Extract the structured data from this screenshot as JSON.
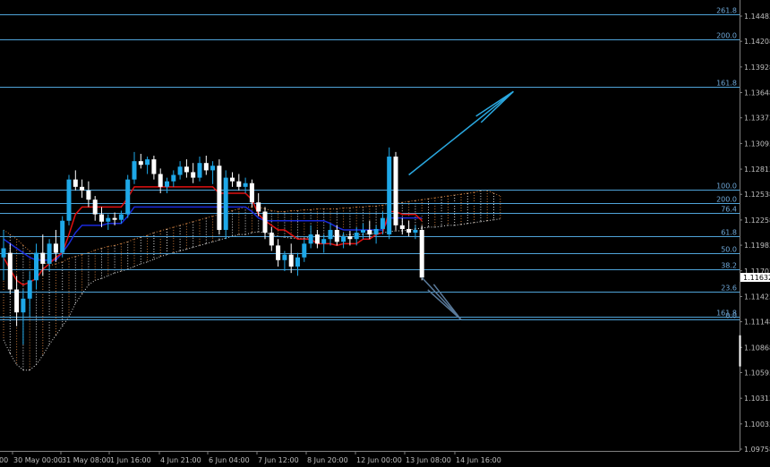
{
  "chart_data": {
    "type": "candlestick",
    "instrument": "",
    "y_axis": {
      "ticks": [
        "1.14483",
        "1.14208",
        "1.13928",
        "1.13648",
        "1.13373",
        "1.13093",
        "1.12813",
        "1.12538",
        "1.12258",
        "1.11983",
        "1.11703",
        "1.11423",
        "1.11148",
        "1.10868",
        "1.10593",
        "1.10313",
        "1.10033",
        "1.09758"
      ],
      "ylim": [
        1.09758,
        1.14483
      ],
      "current_price": "1.11632"
    },
    "x_axis": {
      "ticks": [
        "00",
        "30 May 00:00",
        "31 May 08:00",
        "1 Jun 16:00",
        "4 Jun 21:00",
        "6 Jun 04:00",
        "7 Jun 12:00",
        "8 Jun 20:00",
        "12 Jun 00:00",
        "13 Jun 08:00",
        "14 Jun 16:00"
      ]
    },
    "fibonacci_levels": [
      {
        "label": "261.8",
        "price": 1.145
      },
      {
        "label": "200.0",
        "price": 1.1423
      },
      {
        "label": "161.8",
        "price": 1.1371
      },
      {
        "label": "100.0",
        "price": 1.1259
      },
      {
        "label": "200.0",
        "price": 1.1244
      },
      {
        "label": "76.4",
        "price": 1.1234
      },
      {
        "label": "61.8",
        "price": 1.1208
      },
      {
        "label": "50.0",
        "price": 1.119
      },
      {
        "label": "38.2",
        "price": 1.1172
      },
      {
        "label": "23.6",
        "price": 1.1148
      },
      {
        "label": "161.8",
        "price": 1.112
      },
      {
        "label": "0.0",
        "price": 1.1117
      }
    ],
    "candles": [
      {
        "o": 1.1185,
        "h": 1.1215,
        "l": 1.116,
        "c": 1.1195
      },
      {
        "o": 1.119,
        "h": 1.12,
        "l": 1.1145,
        "c": 1.115
      },
      {
        "o": 1.115,
        "h": 1.1165,
        "l": 1.111,
        "c": 1.1125
      },
      {
        "o": 1.1125,
        "h": 1.115,
        "l": 1.109,
        "c": 1.114
      },
      {
        "o": 1.114,
        "h": 1.117,
        "l": 1.112,
        "c": 1.116
      },
      {
        "o": 1.116,
        "h": 1.12,
        "l": 1.115,
        "c": 1.119
      },
      {
        "o": 1.119,
        "h": 1.121,
        "l": 1.1165,
        "c": 1.1178
      },
      {
        "o": 1.1178,
        "h": 1.1205,
        "l": 1.117,
        "c": 1.12
      },
      {
        "o": 1.12,
        "h": 1.1215,
        "l": 1.118,
        "c": 1.119
      },
      {
        "o": 1.119,
        "h": 1.123,
        "l": 1.1185,
        "c": 1.1225
      },
      {
        "o": 1.1225,
        "h": 1.1275,
        "l": 1.122,
        "c": 1.127
      },
      {
        "o": 1.127,
        "h": 1.128,
        "l": 1.1258,
        "c": 1.1262
      },
      {
        "o": 1.1262,
        "h": 1.127,
        "l": 1.125,
        "c": 1.1258
      },
      {
        "o": 1.1258,
        "h": 1.1268,
        "l": 1.124,
        "c": 1.1248
      },
      {
        "o": 1.1248,
        "h": 1.1252,
        "l": 1.1225,
        "c": 1.1232
      },
      {
        "o": 1.1232,
        "h": 1.124,
        "l": 1.1218,
        "c": 1.1224
      },
      {
        "o": 1.1224,
        "h": 1.1232,
        "l": 1.1215,
        "c": 1.1228
      },
      {
        "o": 1.1228,
        "h": 1.1234,
        "l": 1.122,
        "c": 1.1226
      },
      {
        "o": 1.1226,
        "h": 1.1236,
        "l": 1.1222,
        "c": 1.1232
      },
      {
        "o": 1.1232,
        "h": 1.1275,
        "l": 1.1228,
        "c": 1.127
      },
      {
        "o": 1.127,
        "h": 1.13,
        "l": 1.1265,
        "c": 1.129
      },
      {
        "o": 1.129,
        "h": 1.1298,
        "l": 1.1282,
        "c": 1.1286
      },
      {
        "o": 1.1286,
        "h": 1.1295,
        "l": 1.1276,
        "c": 1.1292
      },
      {
        "o": 1.1292,
        "h": 1.1296,
        "l": 1.127,
        "c": 1.1276
      },
      {
        "o": 1.1276,
        "h": 1.1282,
        "l": 1.1255,
        "c": 1.1262
      },
      {
        "o": 1.1262,
        "h": 1.1272,
        "l": 1.1255,
        "c": 1.1268
      },
      {
        "o": 1.1268,
        "h": 1.128,
        "l": 1.1262,
        "c": 1.1275
      },
      {
        "o": 1.1275,
        "h": 1.129,
        "l": 1.127,
        "c": 1.1284
      },
      {
        "o": 1.1284,
        "h": 1.1292,
        "l": 1.1272,
        "c": 1.1278
      },
      {
        "o": 1.1278,
        "h": 1.1288,
        "l": 1.1266,
        "c": 1.1272
      },
      {
        "o": 1.1272,
        "h": 1.1295,
        "l": 1.1268,
        "c": 1.1288
      },
      {
        "o": 1.1288,
        "h": 1.1296,
        "l": 1.1275,
        "c": 1.128
      },
      {
        "o": 1.128,
        "h": 1.129,
        "l": 1.1265,
        "c": 1.1285
      },
      {
        "o": 1.1285,
        "h": 1.1292,
        "l": 1.121,
        "c": 1.1215
      },
      {
        "o": 1.1215,
        "h": 1.128,
        "l": 1.1205,
        "c": 1.1272
      },
      {
        "o": 1.1272,
        "h": 1.1278,
        "l": 1.1262,
        "c": 1.1268
      },
      {
        "o": 1.1268,
        "h": 1.1276,
        "l": 1.1258,
        "c": 1.1262
      },
      {
        "o": 1.1262,
        "h": 1.1272,
        "l": 1.1255,
        "c": 1.1266
      },
      {
        "o": 1.1266,
        "h": 1.127,
        "l": 1.124,
        "c": 1.1245
      },
      {
        "o": 1.1245,
        "h": 1.1255,
        "l": 1.123,
        "c": 1.1235
      },
      {
        "o": 1.1235,
        "h": 1.124,
        "l": 1.1205,
        "c": 1.1212
      },
      {
        "o": 1.1212,
        "h": 1.1218,
        "l": 1.1192,
        "c": 1.1198
      },
      {
        "o": 1.1198,
        "h": 1.1205,
        "l": 1.1175,
        "c": 1.1182
      },
      {
        "o": 1.1182,
        "h": 1.1192,
        "l": 1.117,
        "c": 1.1188
      },
      {
        "o": 1.1188,
        "h": 1.12,
        "l": 1.1168,
        "c": 1.1175
      },
      {
        "o": 1.1175,
        "h": 1.119,
        "l": 1.1165,
        "c": 1.1185
      },
      {
        "o": 1.1185,
        "h": 1.1205,
        "l": 1.118,
        "c": 1.12
      },
      {
        "o": 1.12,
        "h": 1.122,
        "l": 1.1195,
        "c": 1.121
      },
      {
        "o": 1.121,
        "h": 1.1215,
        "l": 1.1195,
        "c": 1.12
      },
      {
        "o": 1.12,
        "h": 1.121,
        "l": 1.119,
        "c": 1.1205
      },
      {
        "o": 1.1205,
        "h": 1.1222,
        "l": 1.1198,
        "c": 1.1215
      },
      {
        "o": 1.1215,
        "h": 1.122,
        "l": 1.1198,
        "c": 1.1202
      },
      {
        "o": 1.1202,
        "h": 1.1212,
        "l": 1.1195,
        "c": 1.1208
      },
      {
        "o": 1.1208,
        "h": 1.1214,
        "l": 1.1198,
        "c": 1.1205
      },
      {
        "o": 1.1205,
        "h": 1.1218,
        "l": 1.1198,
        "c": 1.1212
      },
      {
        "o": 1.1212,
        "h": 1.1222,
        "l": 1.1205,
        "c": 1.1215
      },
      {
        "o": 1.1215,
        "h": 1.1225,
        "l": 1.1205,
        "c": 1.121
      },
      {
        "o": 1.121,
        "h": 1.122,
        "l": 1.12,
        "c": 1.1216
      },
      {
        "o": 1.1216,
        "h": 1.1235,
        "l": 1.121,
        "c": 1.1228
      },
      {
        "o": 1.121,
        "h": 1.1305,
        "l": 1.1205,
        "c": 1.1295
      },
      {
        "o": 1.1295,
        "h": 1.13,
        "l": 1.1215,
        "c": 1.122
      },
      {
        "o": 1.122,
        "h": 1.1228,
        "l": 1.121,
        "c": 1.1216
      },
      {
        "o": 1.1216,
        "h": 1.1225,
        "l": 1.1208,
        "c": 1.1212
      },
      {
        "o": 1.1212,
        "h": 1.122,
        "l": 1.1205,
        "c": 1.1215
      },
      {
        "o": 1.1215,
        "h": 1.122,
        "l": 1.116,
        "c": 1.1163
      }
    ],
    "tenkan_red": [
      1.1185,
      1.1172,
      1.116,
      1.1155,
      1.1158,
      1.1162,
      1.1172,
      1.1178,
      1.1185,
      1.119,
      1.121,
      1.1232,
      1.124,
      1.124,
      1.124,
      1.124,
      1.124,
      1.124,
      1.124,
      1.125,
      1.1262,
      1.1262,
      1.1262,
      1.1262,
      1.1262,
      1.1262,
      1.1262,
      1.1262,
      1.1262,
      1.1262,
      1.1262,
      1.1262,
      1.1262,
      1.1255,
      1.1255,
      1.1255,
      1.1255,
      1.1255,
      1.1248,
      1.1232,
      1.1225,
      1.122,
      1.1215,
      1.1215,
      1.121,
      1.1205,
      1.1205,
      1.1205,
      1.12,
      1.12,
      1.12,
      1.1198,
      1.12,
      1.12,
      1.12,
      1.1205,
      1.1205,
      1.121,
      1.1212,
      1.1235,
      1.1235,
      1.1232,
      1.1232,
      1.1232,
      1.1225
    ],
    "kijun_blue": [
      1.1205,
      1.12,
      1.1195,
      1.119,
      1.1185,
      1.1182,
      1.1182,
      1.1182,
      1.1182,
      1.119,
      1.12,
      1.1212,
      1.122,
      1.122,
      1.122,
      1.122,
      1.1222,
      1.1222,
      1.1222,
      1.123,
      1.124,
      1.124,
      1.124,
      1.124,
      1.124,
      1.124,
      1.124,
      1.124,
      1.124,
      1.124,
      1.124,
      1.124,
      1.124,
      1.124,
      1.124,
      1.124,
      1.124,
      1.124,
      1.1235,
      1.1228,
      1.1225,
      1.1225,
      1.1225,
      1.1225,
      1.1225,
      1.1225,
      1.1225,
      1.1225,
      1.1225,
      1.1225,
      1.1222,
      1.1218,
      1.1215,
      1.1215,
      1.1215,
      1.1215,
      1.1215,
      1.1215,
      1.1215,
      1.1228,
      1.1228,
      1.1228,
      1.1228,
      1.1228,
      1.1228
    ],
    "cloud_span_a": [
      1.1215,
      1.121,
      1.1205,
      1.1198,
      1.1192,
      1.1186,
      1.118,
      1.1176,
      1.1178,
      1.118,
      1.1184,
      1.1186,
      1.1188,
      1.119,
      1.1193,
      1.1195,
      1.1197,
      1.1198,
      1.12,
      1.1202,
      1.1205,
      1.1207,
      1.1209,
      1.1212,
      1.1214,
      1.1216,
      1.1218,
      1.122,
      1.1222,
      1.1224,
      1.1226,
      1.1228,
      1.123,
      1.1232,
      1.1234,
      1.1236,
      1.1238,
      1.124,
      1.124,
      1.124,
      1.1238,
      1.1236,
      1.1235,
      1.1235,
      1.1236,
      1.1236,
      1.1237,
      1.1237,
      1.1238,
      1.1238,
      1.1238,
      1.1238,
      1.1239,
      1.1239,
      1.124,
      1.124,
      1.1241,
      1.1241,
      1.1242,
      1.1243,
      1.1244,
      1.1245,
      1.1246,
      1.1247,
      1.1248,
      1.1249,
      1.125,
      1.1251,
      1.1252,
      1.1253,
      1.1254,
      1.1255,
      1.1256,
      1.1258,
      1.1258,
      1.1255,
      1.1252
    ],
    "cloud_span_b": [
      1.1095,
      1.108,
      1.1068,
      1.1062,
      1.1062,
      1.1068,
      1.1078,
      1.109,
      1.11,
      1.111,
      1.112,
      1.1135,
      1.1145,
      1.1155,
      1.116,
      1.1162,
      1.1165,
      1.1168,
      1.117,
      1.1172,
      1.1175,
      1.1178,
      1.118,
      1.1183,
      1.1186,
      1.1188,
      1.119,
      1.1192,
      1.1194,
      1.1196,
      1.1198,
      1.12,
      1.1202,
      1.1204,
      1.1206,
      1.1208,
      1.121,
      1.121,
      1.1212,
      1.1213,
      1.1212,
      1.121,
      1.1208,
      1.1207,
      1.1206,
      1.1206,
      1.1206,
      1.1207,
      1.1208,
      1.1208,
      1.1208,
      1.1209,
      1.1209,
      1.121,
      1.121,
      1.121,
      1.1211,
      1.1211,
      1.1212,
      1.1213,
      1.1214,
      1.1214,
      1.1215,
      1.1216,
      1.1217,
      1.1218,
      1.1218,
      1.1219,
      1.122,
      1.122,
      1.1221,
      1.1222,
      1.1223,
      1.1224,
      1.1225,
      1.1226,
      1.1227
    ],
    "projections": [
      {
        "name": "up",
        "from": [
          62,
          1.1275
        ],
        "to": [
          78,
          1.1366
        ]
      },
      {
        "name": "down",
        "from": [
          64,
          1.1163
        ],
        "to": [
          70,
          1.1117
        ]
      }
    ]
  },
  "colors": {
    "background": "#000000",
    "fib_line": "#4fa3d8",
    "axis_text": "#bfbfbf",
    "fib_text": "#6fa8d8",
    "bull": "#1ea8e8",
    "bear": "#ffffff",
    "tenkan": "#e01010",
    "kijun": "#1a2adc",
    "cloud_a": "#c87a3a",
    "cloud_b": "#d8d8d8",
    "projection_up": "#2aa8e0",
    "projection_down": "#5a7a9a",
    "price_box_bg": "#ffffff",
    "price_box_text": "#000000"
  }
}
